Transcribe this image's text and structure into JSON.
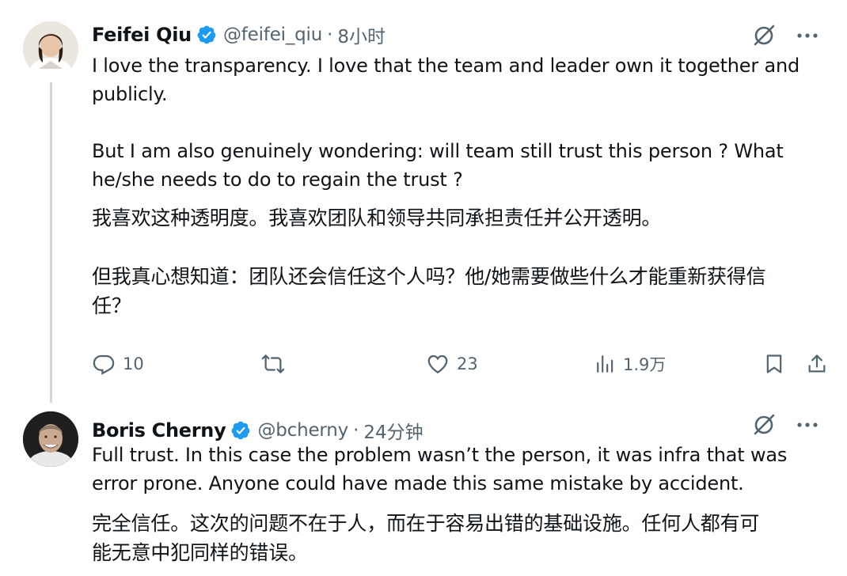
{
  "tweets": [
    {
      "name": "Feifei Qiu",
      "handle": "@feifei_qiu",
      "separator": "·",
      "time": "8小时",
      "text_en": "I love the transparency. I love that the team and leader own it together and\npublicly.\n\nBut I am also genuinely wondering: will team still trust this person ? What\nhe/she needs to do to regain the trust ?",
      "text_cn": "我喜欢这种透明度。我喜欢团队和领导共同承担责任并公开透明。\n\n但我真心想知道：团队还会信任这个人吗？他/她需要做些什么才能重新获得信\n任？",
      "actions": {
        "reply_count": "10",
        "retweet_count": "",
        "like_count": "23",
        "views_count": "1.9万"
      }
    },
    {
      "name": "Boris Cherny",
      "handle": "@bcherny",
      "separator": "·",
      "time": "24分钟",
      "text_en": "Full trust. In this case the problem wasn’t the person, it was infra that was\nerror prone. Anyone could have made this same mistake by accident.",
      "text_cn": "完全信任。这次的问题不在于人，而在于容易出错的基础设施。任何人都有可\n能无意中犯同样的错误。"
    }
  ],
  "icons": {
    "verified": "verified-badge-icon",
    "grok": "grok-icon",
    "more": "more-icon",
    "reply": "reply-icon",
    "retweet": "retweet-icon",
    "like": "like-icon",
    "views": "views-icon",
    "bookmark": "bookmark-icon",
    "share": "share-icon"
  },
  "colors": {
    "text": "#0f1419",
    "secondary": "#536471",
    "verified": "#1d9bf0",
    "thread_line": "#cfd9de"
  }
}
